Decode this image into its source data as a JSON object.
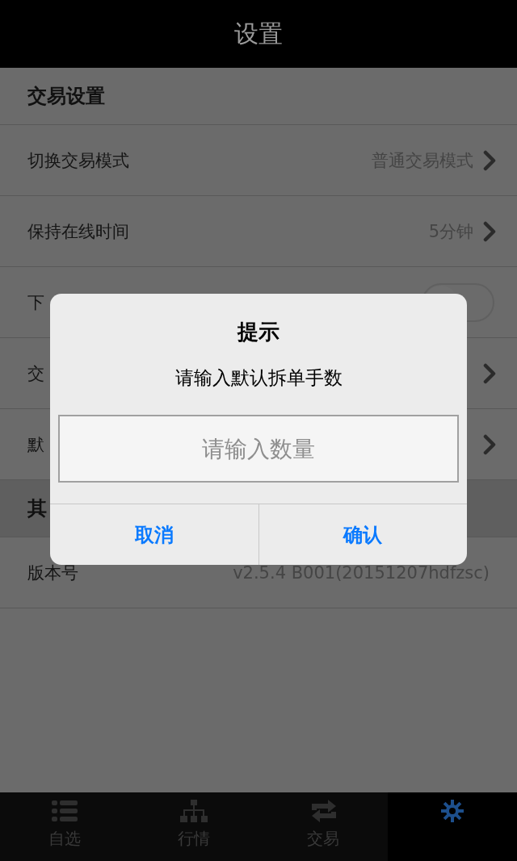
{
  "header": {
    "title": "设置"
  },
  "sections": [
    {
      "title": "交易设置",
      "rows": [
        {
          "kind": "link",
          "label": "切换交易模式",
          "value": "普通交易模式"
        },
        {
          "kind": "link",
          "label": "保持在线时间",
          "value": "5分钟"
        },
        {
          "kind": "toggle",
          "label": "下",
          "on": false
        },
        {
          "kind": "link",
          "label": "交"
        },
        {
          "kind": "link",
          "label": "默"
        }
      ]
    },
    {
      "title": "其",
      "rows": [
        {
          "kind": "info",
          "label": "版本号",
          "value": "v2.5.4 B001(20151207hdfzsc)"
        }
      ]
    }
  ],
  "dialog": {
    "title": "提示",
    "message": "请输入默认拆单手数",
    "input": {
      "placeholder": "请输入数量"
    },
    "buttons": [
      "取消",
      "确认"
    ]
  },
  "tab_bar": [
    {
      "label": "自选",
      "selected": false
    },
    {
      "label": "行情",
      "selected": false
    },
    {
      "label": "交易",
      "selected": false
    },
    {
      "selected": true
    }
  ]
}
